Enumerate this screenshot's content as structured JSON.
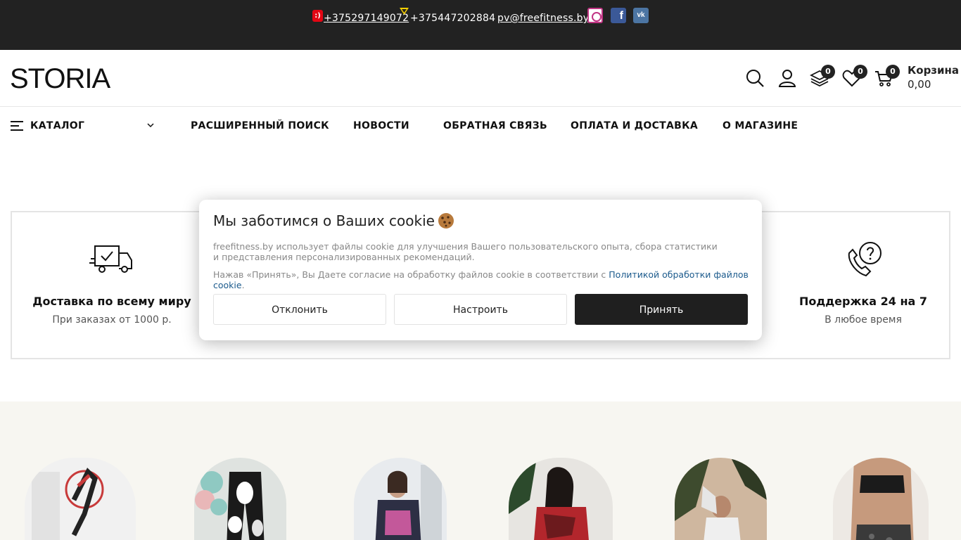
{
  "topbar": {
    "mts_mark": ":)",
    "phone1": "+375297149072",
    "phone2": "+375447202884",
    "email": "pv@freefitness.by",
    "social": [
      "instagram-icon",
      "facebook-icon",
      "vk-icon"
    ],
    "fb_letter": "f",
    "vk_letters": "vk"
  },
  "header": {
    "logo": "STORIA",
    "compare_count": "0",
    "wishlist_count": "0",
    "cart_count": "0",
    "cart_label": "Корзина",
    "cart_total": "0,00"
  },
  "nav": {
    "catalog": "Каталог",
    "items": [
      "Расширенный поиск",
      "Новости",
      "Обратная связь",
      "Оплата и доставка",
      "О магазине"
    ]
  },
  "features": [
    {
      "title": "Доставка по всему миру",
      "subtitle": "При заказах от 1000 р.",
      "icon": "truck-icon"
    },
    {
      "title": "Поддержка 24 на 7",
      "subtitle": "В любое время",
      "icon": "phone-support-icon"
    }
  ],
  "cookie": {
    "title": "Мы заботимся о Ваших cookie",
    "line1": "freefitness.by использует файлы cookie для улучшения Вашего пользовательского опыта, сбора статистики",
    "line2": "и представления персонализированных рекомендаций.",
    "line3_prefix": "Нажав «Принять», Вы Даете согласие на обработку файлов cookie в соответствии с ",
    "line3_link": "Политикой обработки файлов cookie",
    "line3_suffix": ".",
    "decline": "Отклонить",
    "configure": "Настроить",
    "accept": "Принять"
  },
  "colors": {
    "topbar_bg": "#222222",
    "accent_dark": "#1f1f1f",
    "link_blue": "#1b5a8c",
    "cats_bg": "#f7f6f1"
  }
}
